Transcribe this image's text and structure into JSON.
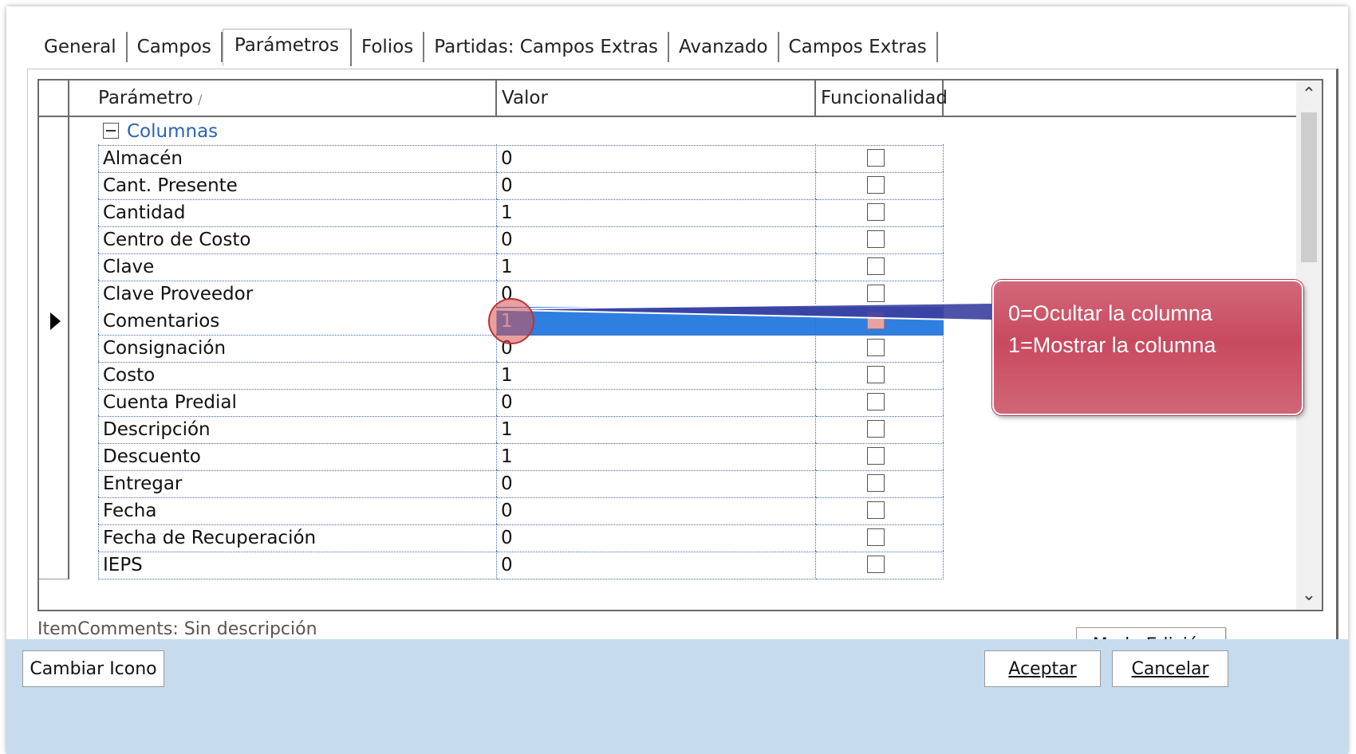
{
  "tabs": [
    "General",
    "Campos",
    "Parámetros",
    "Folios",
    "Partidas: Campos Extras",
    "Avanzado",
    "Campos Extras"
  ],
  "active_tab": "Parámetros",
  "grid": {
    "headers": {
      "param": "Parámetro",
      "sort_indicator": "/",
      "value": "Valor",
      "func": "Funcionalidad"
    },
    "group": "Columnas",
    "rows": [
      {
        "name": "Almacén",
        "value": "0"
      },
      {
        "name": "Cant. Presente",
        "value": "0"
      },
      {
        "name": "Cantidad",
        "value": "1"
      },
      {
        "name": "Centro de Costo",
        "value": "0"
      },
      {
        "name": "Clave",
        "value": "1"
      },
      {
        "name": "Clave Proveedor",
        "value": "0"
      },
      {
        "name": "Comentarios",
        "value": "1"
      },
      {
        "name": "Consignación",
        "value": "0"
      },
      {
        "name": "Costo",
        "value": "1"
      },
      {
        "name": "Cuenta Predial",
        "value": "0"
      },
      {
        "name": "Descripción",
        "value": "1"
      },
      {
        "name": "Descuento",
        "value": "1"
      },
      {
        "name": "Entregar",
        "value": "0"
      },
      {
        "name": "Fecha",
        "value": "0"
      },
      {
        "name": "Fecha de Recuperación",
        "value": "0"
      },
      {
        "name": "IEPS",
        "value": "0"
      }
    ],
    "selected_row": "Comentarios"
  },
  "status_text": "ItemComments: Sin descripción",
  "mode_button": "Modo Edición",
  "footer": {
    "change_icon": "Cambiar Icono",
    "accept": "Aceptar",
    "cancel": "Cancelar"
  },
  "callout": {
    "line1": "0=Ocultar la columna",
    "line2": "1=Mostrar la columna"
  }
}
